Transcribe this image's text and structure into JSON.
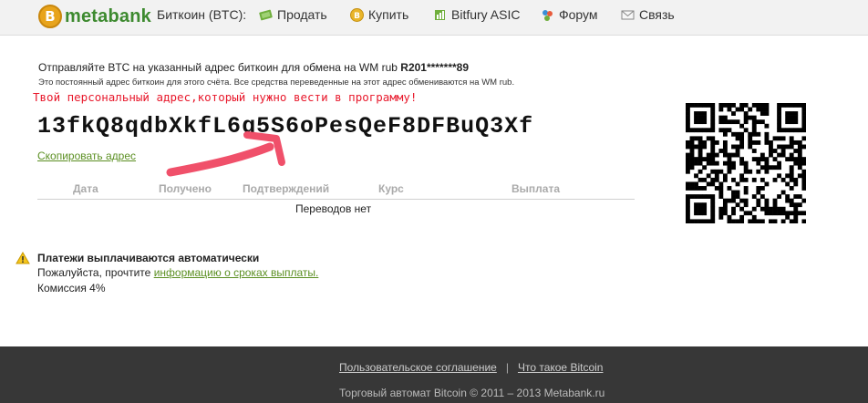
{
  "header": {
    "logo_text": "metabank",
    "logo_coin": "B",
    "nav": [
      {
        "label": "Биткоин (BTC):",
        "icon": "none"
      },
      {
        "label": "Продать",
        "icon": "sell-icon"
      },
      {
        "label": "Купить",
        "icon": "buy-icon"
      },
      {
        "label": "Bitfury ASIC",
        "icon": "chip-icon"
      },
      {
        "label": "Форум",
        "icon": "forum-icon"
      },
      {
        "label": "Связь",
        "icon": "mail-icon"
      }
    ]
  },
  "main": {
    "send_info_prefix": "Отправляйте BTC на указанный адрес биткоин для обмена на WM rub",
    "send_info_account": "R201*******89",
    "permanent_note": "Это постоянный адрес биткоин для этого счёта. Все средства переведенные на этот адрес обмениваются на WM rub.",
    "red_note": "Твой персональный адрес,который нужно вести в программу!",
    "btc_address": "13fkQ8qdbXkfL6g5S6oPesQeF8DFBuQ3Xf",
    "copy_link": "Скопировать адрес",
    "table": {
      "headers": [
        "Дата",
        "Получено",
        "Подтверждений",
        "Курс",
        "Выплата"
      ],
      "empty": "Переводов нет"
    },
    "auto_title": "Платежи выплачиваются автоматически",
    "read_prefix": "Пожалуйста, прочтите",
    "read_link": "информацию о сроках выплаты.",
    "commission": "Комиссия 4%"
  },
  "footer": {
    "links": [
      "Пользовательское соглашение",
      "Что такое Bitcoin"
    ],
    "separator": "|",
    "copyright": "Торговый автомат Bitcoin © 2011 – 2013 Metabank.ru"
  },
  "colors": {
    "accent_green": "#5b8f22",
    "red_note": "#e8192c",
    "arrow_pink": "#f0506a",
    "footer_bg": "#373737"
  }
}
